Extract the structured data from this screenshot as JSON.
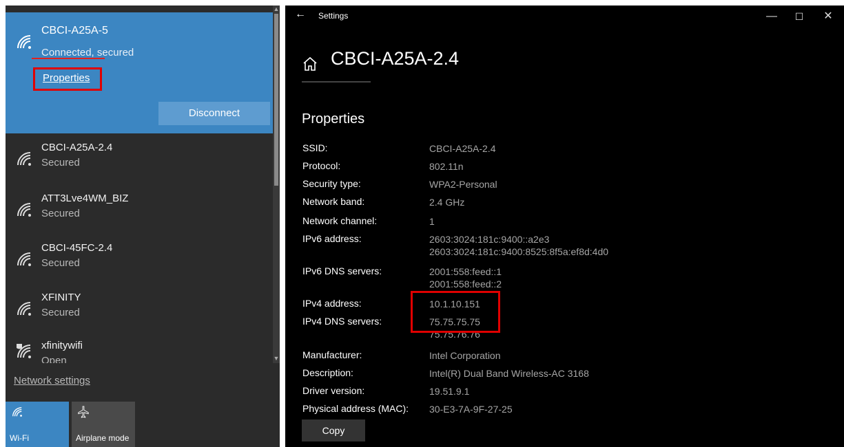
{
  "flyout": {
    "connected": {
      "name": "CBCI-A25A-5",
      "status": "Connected, secured",
      "properties_link": "Properties",
      "disconnect_label": "Disconnect"
    },
    "networks": [
      {
        "name": "CBCI-A25A-2.4",
        "status": "Secured"
      },
      {
        "name": "ATT3Lve4WM_BIZ",
        "status": "Secured"
      },
      {
        "name": "CBCI-45FC-2.4",
        "status": "Secured"
      },
      {
        "name": "XFINITY",
        "status": "Secured"
      },
      {
        "name": "xfinitywifi",
        "status": "Open"
      }
    ],
    "network_settings_link": "Network settings",
    "tiles": {
      "wifi_label": "Wi-Fi",
      "airplane_label": "Airplane mode"
    }
  },
  "settings": {
    "window_title": "Settings",
    "page_title": "CBCI-A25A-2.4",
    "section_title": "Properties",
    "properties": [
      {
        "label": "SSID:",
        "value": "CBCI-A25A-2.4"
      },
      {
        "label": "Protocol:",
        "value": "802.11n"
      },
      {
        "label": "Security type:",
        "value": "WPA2-Personal"
      },
      {
        "label": "Network band:",
        "value": "2.4 GHz"
      },
      {
        "label": "Network channel:",
        "value": "1"
      },
      {
        "label": "IPv6 address:",
        "value": "2603:3024:181c:9400::a2e3",
        "value2": "2603:3024:181c:9400:8525:8f5a:ef8d:4d0"
      },
      {
        "label": "IPv6 DNS servers:",
        "value": "2001:558:feed::1",
        "value2": "2001:558:feed::2"
      },
      {
        "label": "IPv4 address:",
        "value": "10.1.10.151"
      },
      {
        "label": "IPv4 DNS servers:",
        "value": "75.75.75.75",
        "value2": "75.75.76.76"
      },
      {
        "label": "Manufacturer:",
        "value": "Intel Corporation"
      },
      {
        "label": "Description:",
        "value": "Intel(R) Dual Band Wireless-AC 3168"
      },
      {
        "label": "Driver version:",
        "value": "19.51.9.1"
      },
      {
        "label": "Physical address (MAC):",
        "value": "30-E3-7A-9F-27-25"
      }
    ],
    "copy_label": "Copy"
  },
  "colors": {
    "accent": "#3c86c2",
    "highlight_box": "#e00000",
    "settings_bg": "#000000",
    "flyout_bg": "#2b2b2b"
  },
  "icons": [
    "wifi-icon",
    "wifi-open-icon",
    "airplane-icon",
    "back-icon",
    "home-icon",
    "minimize-icon",
    "maximize-icon",
    "close-icon"
  ]
}
